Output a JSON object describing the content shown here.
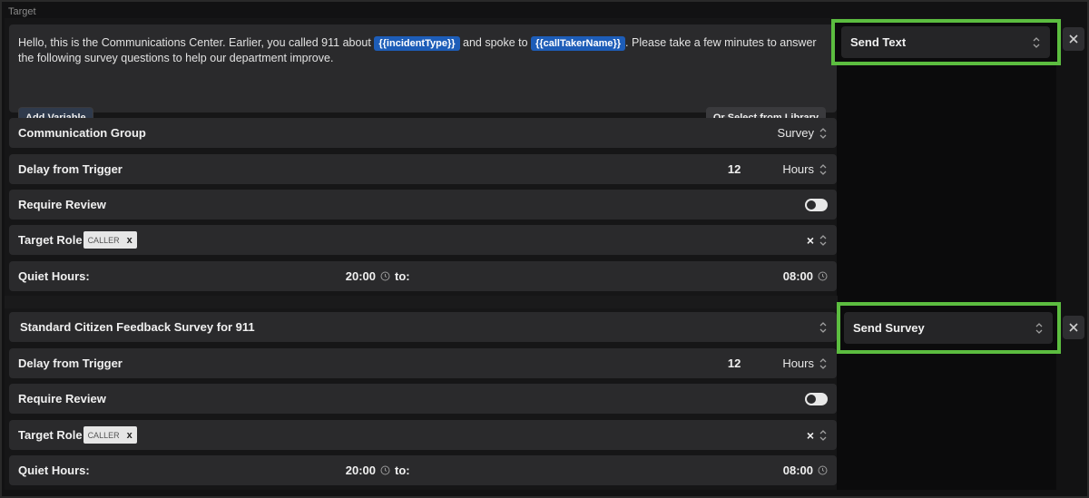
{
  "section_label": "Target",
  "text_block": {
    "message_parts": {
      "p1": "Hello, this is the Communications Center. Earlier, you called 911 about",
      "var1": "{{incidentType}}",
      "p2": "and spoke to",
      "var2": "{{callTakerName}}",
      "p3": ". Please take a few minutes to answer the following survey questions to help our department improve."
    },
    "add_variable_label": "Add Variable",
    "select_library_label": "Or Select from Library",
    "communication_group_label": "Communication Group",
    "communication_group_value": "Survey",
    "delay_label": "Delay from Trigger",
    "delay_value": "12",
    "delay_unit": "Hours",
    "require_review_label": "Require Review",
    "target_role_label": "Target Role",
    "target_role_tag": "CALLER",
    "tag_remove": "x",
    "clear_label": "×",
    "quiet_hours_label": "Quiet Hours:",
    "quiet_from": "20:00",
    "quiet_to_label": "to:",
    "quiet_to": "08:00",
    "action_label": "Send Text"
  },
  "survey_block": {
    "survey_name": "Standard Citizen Feedback Survey for 911",
    "delay_label": "Delay from Trigger",
    "delay_value": "12",
    "delay_unit": "Hours",
    "require_review_label": "Require Review",
    "target_role_label": "Target Role",
    "target_role_tag": "CALLER",
    "tag_remove": "x",
    "clear_label": "×",
    "quiet_hours_label": "Quiet Hours:",
    "quiet_from": "20:00",
    "quiet_to_label": "to:",
    "quiet_to": "08:00",
    "action_label": "Send Survey"
  },
  "icons": {
    "updown": "chevrons-up-down-icon",
    "clock": "clock-icon",
    "close": "close-icon"
  },
  "colors": {
    "highlight": "#5cbd40",
    "variable_chip": "#1d5db8",
    "card": "#2a2a2c"
  }
}
